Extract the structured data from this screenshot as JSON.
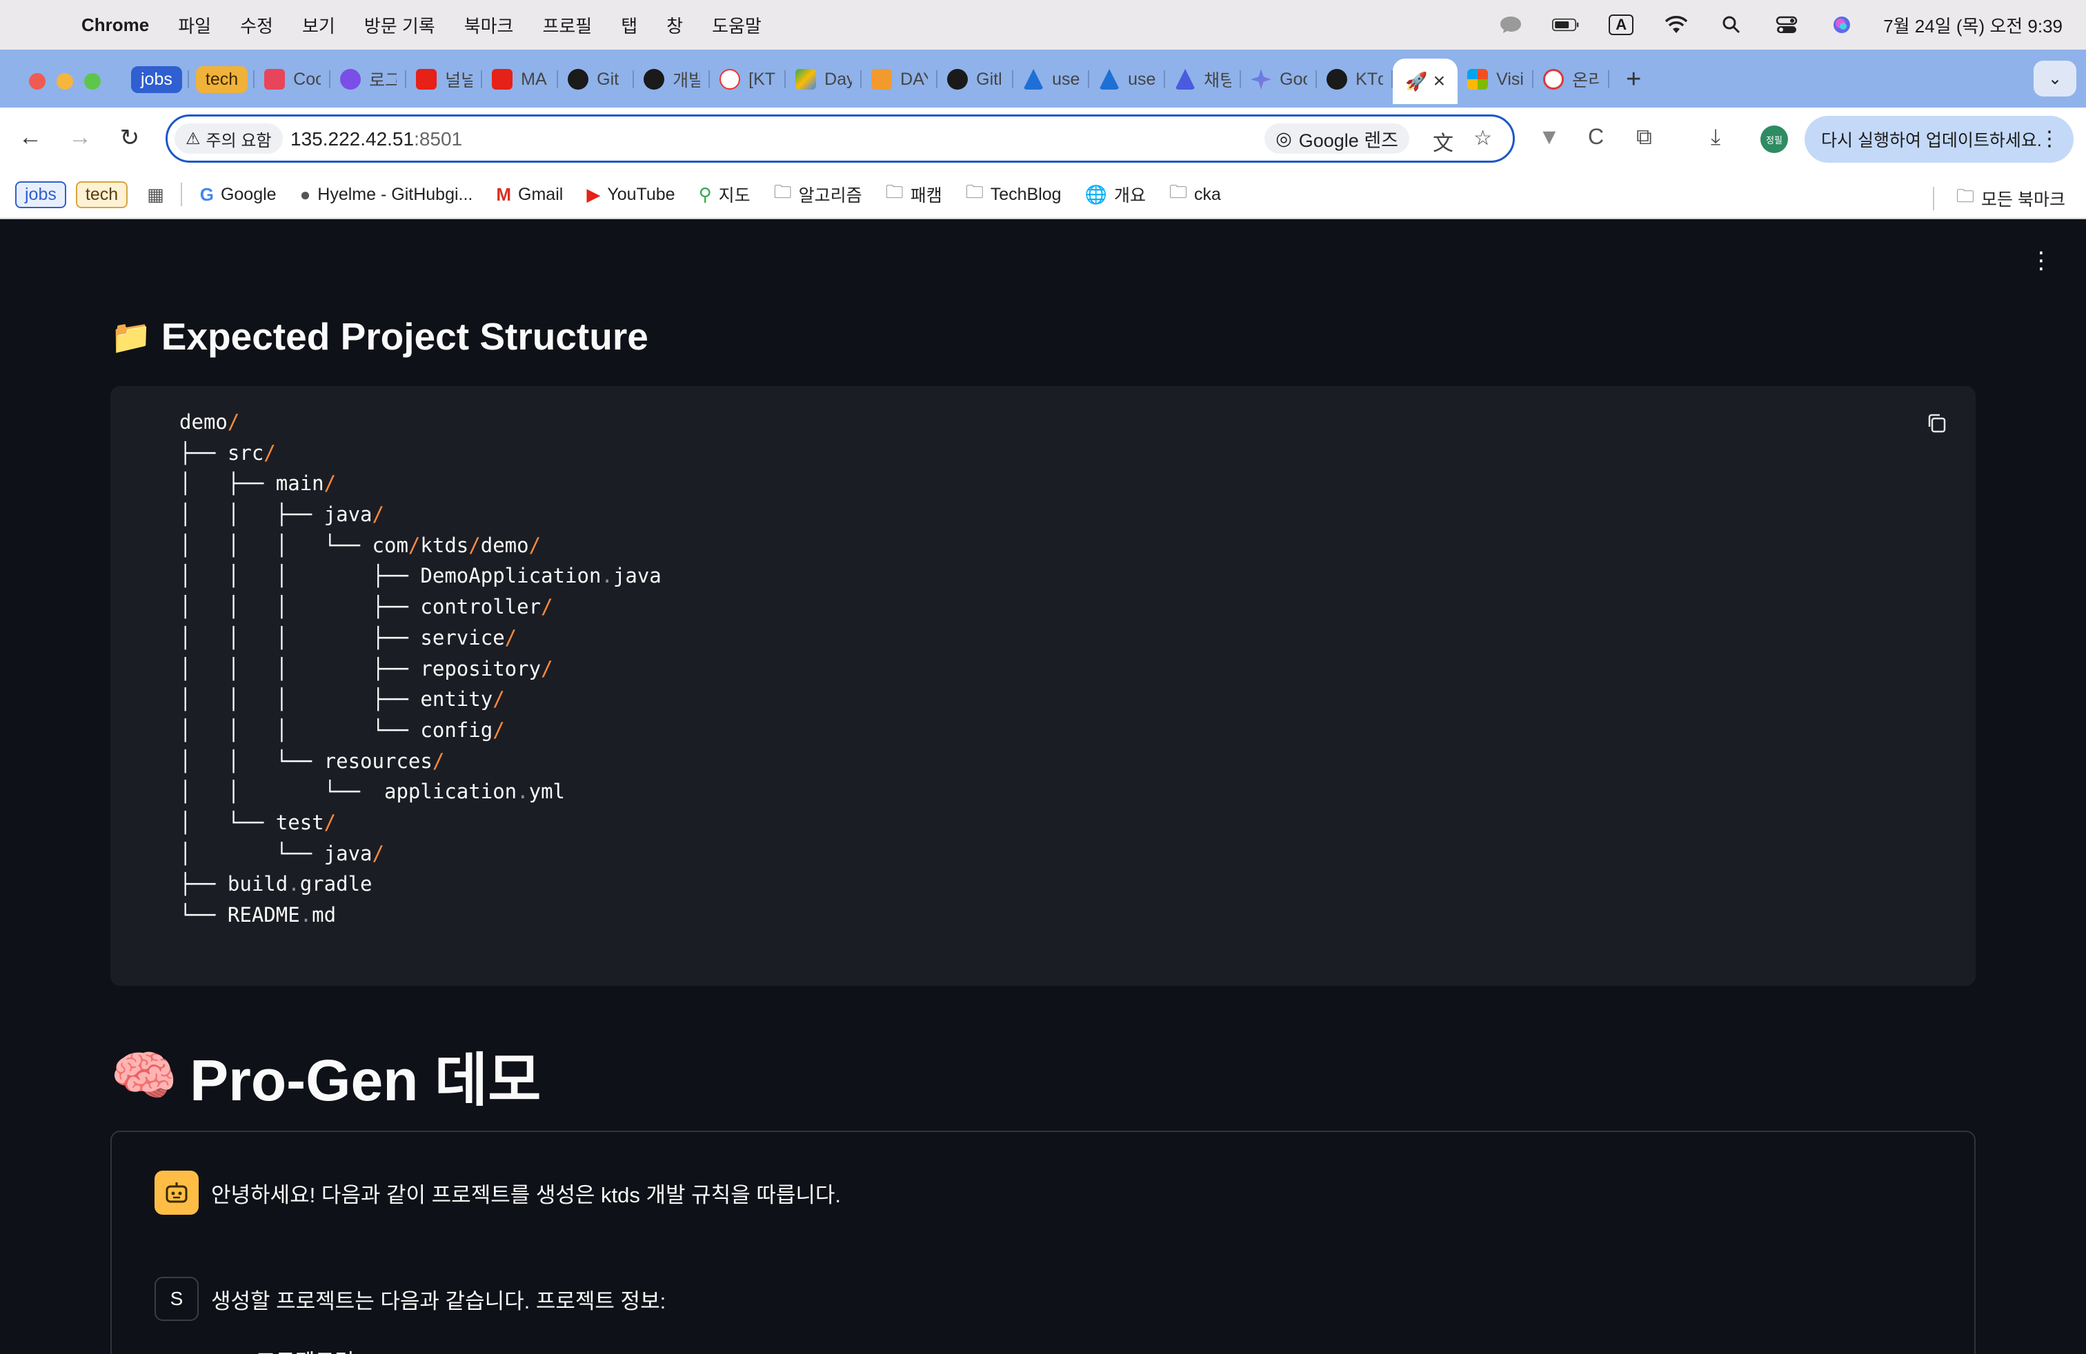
{
  "menubar": {
    "app": "Chrome",
    "items": [
      "파일",
      "수정",
      "보기",
      "방문 기록",
      "북마크",
      "프로필",
      "탭",
      "창",
      "도움말"
    ],
    "input_indicator": "A",
    "datetime": "7월 24일 (목) 오전 9:39"
  },
  "tabs": {
    "group_jobs": "jobs",
    "group_tech": "tech",
    "items": [
      "Coo",
      "로그",
      "널널",
      "MA",
      "Git",
      "개발",
      "[KT",
      "Day",
      "DAY",
      "Gitl",
      "use",
      "use",
      "채팅",
      "Goo",
      "KTd",
      "",
      "Visi",
      "온리"
    ],
    "active_close": "×",
    "new_tab": "+"
  },
  "toolbar": {
    "security_label": "주의 요함",
    "url_host": "135.222.42.51",
    "url_port": ":8501",
    "lens_label": "Google 렌즈",
    "profile_label": "정필",
    "update_label": "다시 실행하여 업데이트하세요."
  },
  "bookmarks": {
    "chip_jobs": "jobs",
    "chip_tech": "tech",
    "items": [
      "Google",
      "Hyelme - GitHubgi...",
      "Gmail",
      "YouTube",
      "지도",
      "알고리즘",
      "패캠",
      "TechBlog",
      "개요",
      "cka"
    ],
    "all": "모든 북마크"
  },
  "colors": {
    "app_background": "#0e1117",
    "code_background": "#1b1d24",
    "slash_accent": "#ff8a3d",
    "bot_avatar": "#ffbd45",
    "tabstrip": "#8fb2ea",
    "omnibox_border": "#1a57c9"
  },
  "content": {
    "structure_icon": "📁",
    "structure_title": "Expected Project Structure",
    "code_lines": [
      "demo/",
      "├── src/",
      "│   ├── main/",
      "│   │   ├── java/",
      "│   │   │   └── com/ktds/demo/",
      "│   │   │       ├── DemoApplication.java",
      "│   │   │       ├── controller/",
      "│   │   │       ├── service/",
      "│   │   │       ├── repository/",
      "│   │   │       ├── entity/",
      "│   │   │       └── config/",
      "│   │   └── resources/",
      "│   │       └──  application.yml",
      "│   └── test/",
      "│       └── java/",
      "├── build.gradle",
      "└── README.md"
    ],
    "demo_icon": "🧠",
    "demo_title": "Pro-Gen 데모",
    "bot_message": "안녕하세요! 다음과 같이 프로젝트를 생성은 ktds 개발 규칙을 따릅니다.",
    "user_avatar": "S",
    "user_message": "생성할 프로젝트는 다음과 같습니다. 프로젝트 정보:",
    "cut_message": "- 프로젝트명: d"
  }
}
